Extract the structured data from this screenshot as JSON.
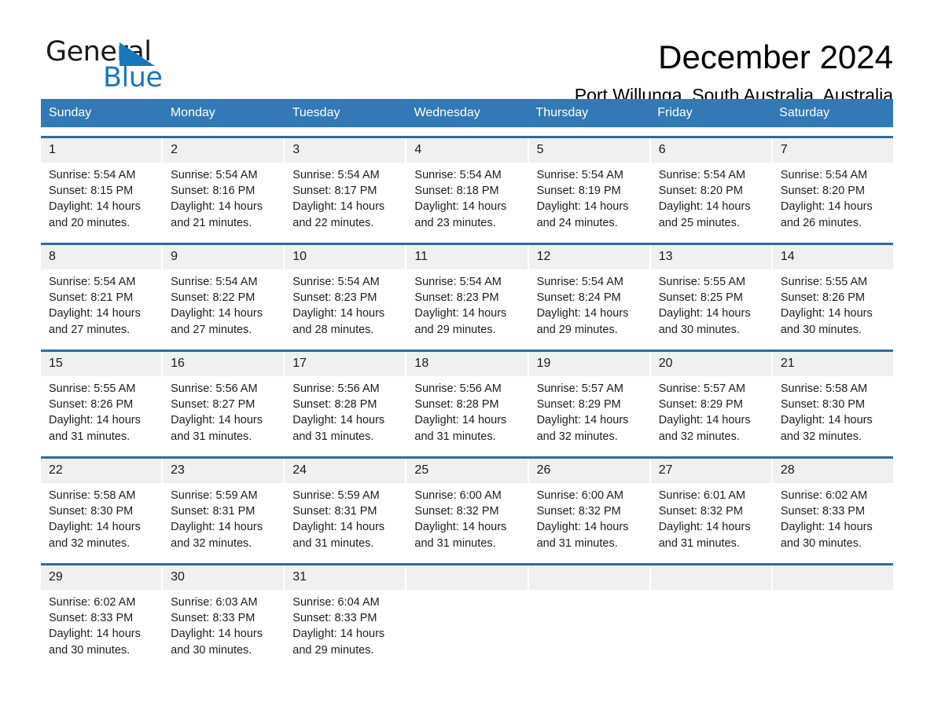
{
  "brand": {
    "name_top": "General",
    "name_bottom": "Blue",
    "accent_color": "#1878be"
  },
  "header": {
    "title": "December 2024",
    "location": "Port Willunga, South Australia, Australia"
  },
  "theme": {
    "header_row_bg": "#3279b6",
    "week_divider": "#2b6ca3",
    "day_number_bg": "#f0f0f0"
  },
  "weekdays": [
    "Sunday",
    "Monday",
    "Tuesday",
    "Wednesday",
    "Thursday",
    "Friday",
    "Saturday"
  ],
  "weeks": [
    [
      {
        "day": "1",
        "sunrise": "Sunrise: 5:54 AM",
        "sunset": "Sunset: 8:15 PM",
        "daylight_line1": "Daylight: 14 hours",
        "daylight_line2": "and 20 minutes."
      },
      {
        "day": "2",
        "sunrise": "Sunrise: 5:54 AM",
        "sunset": "Sunset: 8:16 PM",
        "daylight_line1": "Daylight: 14 hours",
        "daylight_line2": "and 21 minutes."
      },
      {
        "day": "3",
        "sunrise": "Sunrise: 5:54 AM",
        "sunset": "Sunset: 8:17 PM",
        "daylight_line1": "Daylight: 14 hours",
        "daylight_line2": "and 22 minutes."
      },
      {
        "day": "4",
        "sunrise": "Sunrise: 5:54 AM",
        "sunset": "Sunset: 8:18 PM",
        "daylight_line1": "Daylight: 14 hours",
        "daylight_line2": "and 23 minutes."
      },
      {
        "day": "5",
        "sunrise": "Sunrise: 5:54 AM",
        "sunset": "Sunset: 8:19 PM",
        "daylight_line1": "Daylight: 14 hours",
        "daylight_line2": "and 24 minutes."
      },
      {
        "day": "6",
        "sunrise": "Sunrise: 5:54 AM",
        "sunset": "Sunset: 8:20 PM",
        "daylight_line1": "Daylight: 14 hours",
        "daylight_line2": "and 25 minutes."
      },
      {
        "day": "7",
        "sunrise": "Sunrise: 5:54 AM",
        "sunset": "Sunset: 8:20 PM",
        "daylight_line1": "Daylight: 14 hours",
        "daylight_line2": "and 26 minutes."
      }
    ],
    [
      {
        "day": "8",
        "sunrise": "Sunrise: 5:54 AM",
        "sunset": "Sunset: 8:21 PM",
        "daylight_line1": "Daylight: 14 hours",
        "daylight_line2": "and 27 minutes."
      },
      {
        "day": "9",
        "sunrise": "Sunrise: 5:54 AM",
        "sunset": "Sunset: 8:22 PM",
        "daylight_line1": "Daylight: 14 hours",
        "daylight_line2": "and 27 minutes."
      },
      {
        "day": "10",
        "sunrise": "Sunrise: 5:54 AM",
        "sunset": "Sunset: 8:23 PM",
        "daylight_line1": "Daylight: 14 hours",
        "daylight_line2": "and 28 minutes."
      },
      {
        "day": "11",
        "sunrise": "Sunrise: 5:54 AM",
        "sunset": "Sunset: 8:23 PM",
        "daylight_line1": "Daylight: 14 hours",
        "daylight_line2": "and 29 minutes."
      },
      {
        "day": "12",
        "sunrise": "Sunrise: 5:54 AM",
        "sunset": "Sunset: 8:24 PM",
        "daylight_line1": "Daylight: 14 hours",
        "daylight_line2": "and 29 minutes."
      },
      {
        "day": "13",
        "sunrise": "Sunrise: 5:55 AM",
        "sunset": "Sunset: 8:25 PM",
        "daylight_line1": "Daylight: 14 hours",
        "daylight_line2": "and 30 minutes."
      },
      {
        "day": "14",
        "sunrise": "Sunrise: 5:55 AM",
        "sunset": "Sunset: 8:26 PM",
        "daylight_line1": "Daylight: 14 hours",
        "daylight_line2": "and 30 minutes."
      }
    ],
    [
      {
        "day": "15",
        "sunrise": "Sunrise: 5:55 AM",
        "sunset": "Sunset: 8:26 PM",
        "daylight_line1": "Daylight: 14 hours",
        "daylight_line2": "and 31 minutes."
      },
      {
        "day": "16",
        "sunrise": "Sunrise: 5:56 AM",
        "sunset": "Sunset: 8:27 PM",
        "daylight_line1": "Daylight: 14 hours",
        "daylight_line2": "and 31 minutes."
      },
      {
        "day": "17",
        "sunrise": "Sunrise: 5:56 AM",
        "sunset": "Sunset: 8:28 PM",
        "daylight_line1": "Daylight: 14 hours",
        "daylight_line2": "and 31 minutes."
      },
      {
        "day": "18",
        "sunrise": "Sunrise: 5:56 AM",
        "sunset": "Sunset: 8:28 PM",
        "daylight_line1": "Daylight: 14 hours",
        "daylight_line2": "and 31 minutes."
      },
      {
        "day": "19",
        "sunrise": "Sunrise: 5:57 AM",
        "sunset": "Sunset: 8:29 PM",
        "daylight_line1": "Daylight: 14 hours",
        "daylight_line2": "and 32 minutes."
      },
      {
        "day": "20",
        "sunrise": "Sunrise: 5:57 AM",
        "sunset": "Sunset: 8:29 PM",
        "daylight_line1": "Daylight: 14 hours",
        "daylight_line2": "and 32 minutes."
      },
      {
        "day": "21",
        "sunrise": "Sunrise: 5:58 AM",
        "sunset": "Sunset: 8:30 PM",
        "daylight_line1": "Daylight: 14 hours",
        "daylight_line2": "and 32 minutes."
      }
    ],
    [
      {
        "day": "22",
        "sunrise": "Sunrise: 5:58 AM",
        "sunset": "Sunset: 8:30 PM",
        "daylight_line1": "Daylight: 14 hours",
        "daylight_line2": "and 32 minutes."
      },
      {
        "day": "23",
        "sunrise": "Sunrise: 5:59 AM",
        "sunset": "Sunset: 8:31 PM",
        "daylight_line1": "Daylight: 14 hours",
        "daylight_line2": "and 32 minutes."
      },
      {
        "day": "24",
        "sunrise": "Sunrise: 5:59 AM",
        "sunset": "Sunset: 8:31 PM",
        "daylight_line1": "Daylight: 14 hours",
        "daylight_line2": "and 31 minutes."
      },
      {
        "day": "25",
        "sunrise": "Sunrise: 6:00 AM",
        "sunset": "Sunset: 8:32 PM",
        "daylight_line1": "Daylight: 14 hours",
        "daylight_line2": "and 31 minutes."
      },
      {
        "day": "26",
        "sunrise": "Sunrise: 6:00 AM",
        "sunset": "Sunset: 8:32 PM",
        "daylight_line1": "Daylight: 14 hours",
        "daylight_line2": "and 31 minutes."
      },
      {
        "day": "27",
        "sunrise": "Sunrise: 6:01 AM",
        "sunset": "Sunset: 8:32 PM",
        "daylight_line1": "Daylight: 14 hours",
        "daylight_line2": "and 31 minutes."
      },
      {
        "day": "28",
        "sunrise": "Sunrise: 6:02 AM",
        "sunset": "Sunset: 8:33 PM",
        "daylight_line1": "Daylight: 14 hours",
        "daylight_line2": "and 30 minutes."
      }
    ],
    [
      {
        "day": "29",
        "sunrise": "Sunrise: 6:02 AM",
        "sunset": "Sunset: 8:33 PM",
        "daylight_line1": "Daylight: 14 hours",
        "daylight_line2": "and 30 minutes."
      },
      {
        "day": "30",
        "sunrise": "Sunrise: 6:03 AM",
        "sunset": "Sunset: 8:33 PM",
        "daylight_line1": "Daylight: 14 hours",
        "daylight_line2": "and 30 minutes."
      },
      {
        "day": "31",
        "sunrise": "Sunrise: 6:04 AM",
        "sunset": "Sunset: 8:33 PM",
        "daylight_line1": "Daylight: 14 hours",
        "daylight_line2": "and 29 minutes."
      },
      {
        "day": "",
        "sunrise": "",
        "sunset": "",
        "daylight_line1": "",
        "daylight_line2": ""
      },
      {
        "day": "",
        "sunrise": "",
        "sunset": "",
        "daylight_line1": "",
        "daylight_line2": ""
      },
      {
        "day": "",
        "sunrise": "",
        "sunset": "",
        "daylight_line1": "",
        "daylight_line2": ""
      },
      {
        "day": "",
        "sunrise": "",
        "sunset": "",
        "daylight_line1": "",
        "daylight_line2": ""
      }
    ]
  ]
}
